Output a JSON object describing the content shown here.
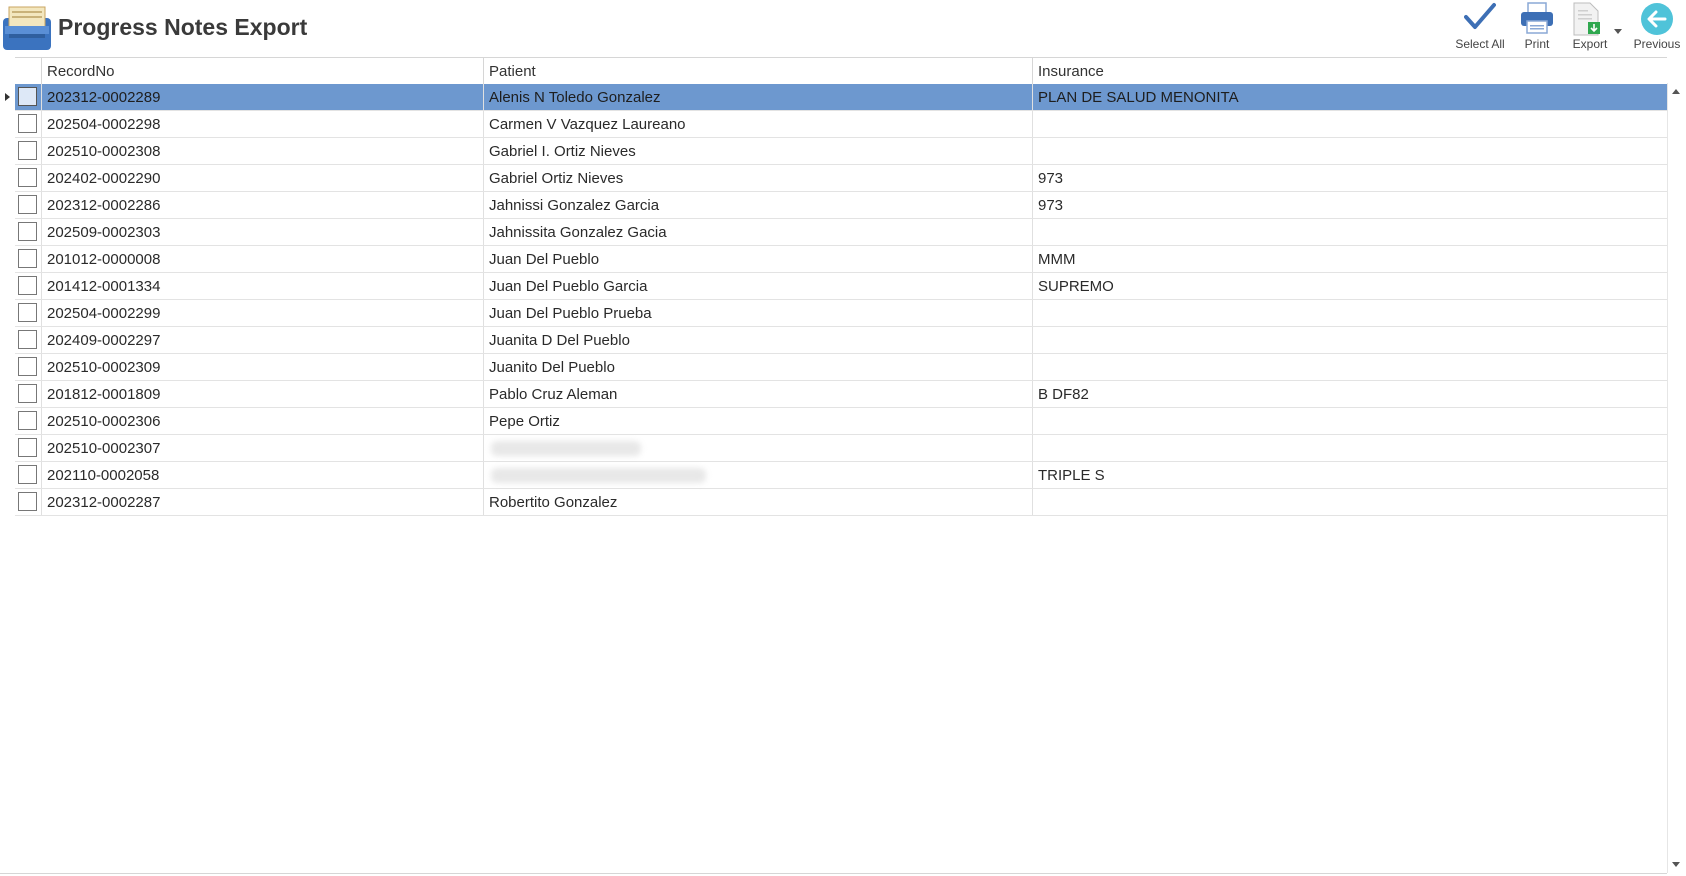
{
  "header": {
    "title": "Progress Notes Export"
  },
  "toolbar": {
    "select_all": "Select All",
    "print": "Print",
    "export": "Export",
    "previous": "Previous"
  },
  "colors": {
    "selected_row": "#6d98cf",
    "accent": "#3b6fb6",
    "previous_icon": "#4fc3d9"
  },
  "grid": {
    "columns": [
      "RecordNo",
      "Patient",
      "Insurance"
    ],
    "rows": [
      {
        "record": "202312-0002289",
        "patient": "Alenis N Toledo Gonzalez",
        "insurance": "PLAN DE SALUD MENONITA",
        "selected": true
      },
      {
        "record": "202504-0002298",
        "patient": "Carmen V Vazquez Laureano",
        "insurance": ""
      },
      {
        "record": "202510-0002308",
        "patient": "Gabriel I. Ortiz Nieves",
        "insurance": ""
      },
      {
        "record": "202402-0002290",
        "patient": "Gabriel Ortiz Nieves",
        "insurance": "973"
      },
      {
        "record": "202312-0002286",
        "patient": "Jahnissi Gonzalez Garcia",
        "insurance": "973"
      },
      {
        "record": "202509-0002303",
        "patient": "Jahnissita Gonzalez Gacia",
        "insurance": ""
      },
      {
        "record": "201012-0000008",
        "patient": "Juan Del Pueblo",
        "insurance": "MMM"
      },
      {
        "record": "201412-0001334",
        "patient": "Juan Del Pueblo Garcia",
        "insurance": "SUPREMO"
      },
      {
        "record": "202504-0002299",
        "patient": "Juan Del Pueblo Prueba",
        "insurance": ""
      },
      {
        "record": "202409-0002297",
        "patient": "Juanita D Del Pueblo",
        "insurance": ""
      },
      {
        "record": "202510-0002309",
        "patient": "Juanito Del Pueblo",
        "insurance": ""
      },
      {
        "record": "201812-0001809",
        "patient": "Pablo Cruz Aleman",
        "insurance": "B DF82"
      },
      {
        "record": "202510-0002306",
        "patient": "Pepe Ortiz",
        "insurance": ""
      },
      {
        "record": "202510-0002307",
        "patient": "",
        "insurance": "",
        "redacted": true
      },
      {
        "record": "202110-0002058",
        "patient": "",
        "insurance": "TRIPLE S",
        "redacted": true
      },
      {
        "record": "202312-0002287",
        "patient": "Robertito Gonzalez",
        "insurance": ""
      }
    ]
  }
}
